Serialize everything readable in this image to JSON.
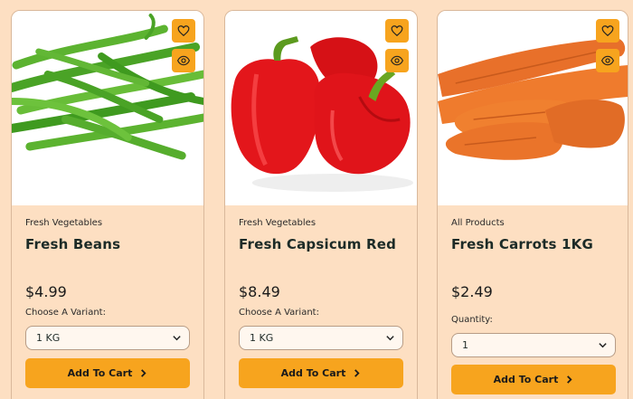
{
  "colors": {
    "background": "#fddfc2",
    "accent": "#f7a41e",
    "border": "#d9b89b"
  },
  "icons": {
    "wishlist": "heart-icon",
    "quick_view": "eye-icon",
    "select": "chevron-down-icon",
    "cart": "chevron-right-icon"
  },
  "products": [
    {
      "image": "green-beans",
      "category": "Fresh Vegetables",
      "name": "Fresh Beans",
      "price": "$4.99",
      "option_label": "Choose A Variant:",
      "option_value": "1 KG",
      "button": "Add To Cart"
    },
    {
      "image": "red-capsicum",
      "category": "Fresh Vegetables",
      "name": "Fresh Capsicum Red",
      "price": "$8.49",
      "option_label": "Choose A Variant:",
      "option_value": "1 KG",
      "button": "Add To Cart"
    },
    {
      "image": "carrots",
      "category": "All Products",
      "name": "Fresh Carrots 1KG",
      "price": "$2.49",
      "option_label": "Quantity:",
      "option_value": "1",
      "button": "Add To Cart"
    }
  ]
}
